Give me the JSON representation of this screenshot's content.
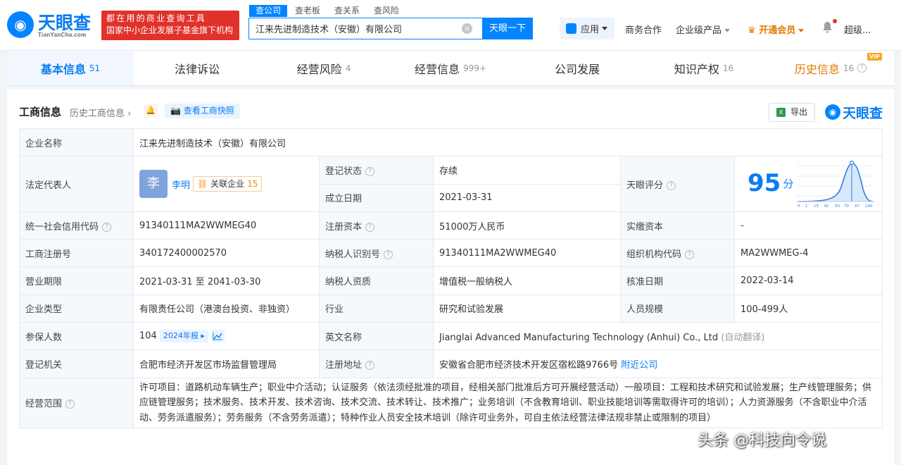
{
  "header": {
    "logo_text": "天眼查",
    "logo_domain": "TianYanCha.com",
    "promo_line1": "都在用的商业查询工具",
    "promo_line2": "国家中小企业发展子基金旗下机构",
    "search_tabs": [
      "查公司",
      "查老板",
      "查关系",
      "查风险"
    ],
    "search_value": "江来先进制造技术（安徽）有限公司",
    "search_button": "天眼一下",
    "apps_label": "应用",
    "nav_business": "商务合作",
    "nav_enterprise": "企业级产品",
    "nav_vip": "开通会员",
    "nav_user": "超级..."
  },
  "tabs": [
    {
      "label": "基本信息",
      "count": "51"
    },
    {
      "label": "法律诉讼",
      "count": ""
    },
    {
      "label": "经营风险",
      "count": "4"
    },
    {
      "label": "经营信息",
      "count": "999+"
    },
    {
      "label": "公司发展",
      "count": ""
    },
    {
      "label": "知识产权",
      "count": "16"
    },
    {
      "label": "历史信息",
      "count": "16",
      "badge": "VIP"
    }
  ],
  "section": {
    "title": "工商信息",
    "history_link": "历史工商信息",
    "snapshot_label": "查看工商快照",
    "export_label": "导出",
    "brand": "天眼查"
  },
  "info": {
    "company_name_label": "企业名称",
    "company_name": "江来先进制造技术（安徽）有限公司",
    "legal_rep_label": "法定代表人",
    "legal_rep_avatar": "李",
    "legal_rep_name": "李明",
    "related_label": "关联企业",
    "related_count": "15",
    "reg_status_label": "登记状态",
    "reg_status": "存续",
    "found_date_label": "成立日期",
    "found_date": "2021-03-31",
    "score_label": "天眼评分",
    "score": "95",
    "score_unit": "分",
    "score_ticks": [
      "0",
      "1",
      "15",
      "30",
      "50",
      "70",
      "97",
      "100"
    ],
    "credit_code_label": "统一社会信用代码",
    "credit_code": "91340111MA2WWMEG40",
    "reg_capital_label": "注册资本",
    "reg_capital": "51000万人民币",
    "paid_capital_label": "实缴资本",
    "paid_capital": "-",
    "reg_no_label": "工商注册号",
    "reg_no": "340172400002570",
    "tax_id_label": "纳税人识别号",
    "tax_id": "91340111MA2WWMEG40",
    "org_code_label": "组织机构代码",
    "org_code": "MA2WWMEG-4",
    "term_label": "营业期限",
    "term": "2021-03-31 至 2041-03-30",
    "taxpayer_label": "纳税人资质",
    "taxpayer": "增值税一般纳税人",
    "approve_label": "核准日期",
    "approve_date": "2022-03-14",
    "type_label": "企业类型",
    "type": "有限责任公司（港澳台投资、非独资）",
    "industry_label": "行业",
    "industry": "研究和试验发展",
    "staff_label": "人员规模",
    "staff": "100-499人",
    "insured_label": "参保人数",
    "insured": "104",
    "report_tag": "2024年报",
    "en_name_label": "英文名称",
    "en_name": "Jianglai Advanced Manufacturing Technology (Anhui) Co., Ltd",
    "auto_translate": "(自动翻译)",
    "authority_label": "登记机关",
    "authority": "合肥市经济开发区市场监督管理局",
    "address_label": "注册地址",
    "address": "安徽省合肥市经济技术开发区宿松路9766号",
    "nearby": "附近公司",
    "scope_label": "经营范围",
    "scope": "许可项目：道路机动车辆生产；职业中介活动；认证服务（依法须经批准的项目，经相关部门批准后方可开展经营活动）一般项目：工程和技术研究和试验发展；生产线管理服务；供应链管理服务；技术服务、技术开发、技术咨询、技术交流、技术转让、技术推广；业务培训（不含教育培训、职业技能培训等需取得许可的培训）；人力资源服务（不含职业中介活动、劳务派遣服务）；劳务服务（不含劳务派遣）；特种作业人员安全技术培训（除许可业务外，可自主依法经营法律法规非禁止或限制的项目）"
  },
  "watermark": "头条 @科技向令说",
  "colors": {
    "brand": "#0084ff",
    "promo": "#e0322b",
    "vip": "#e07b00",
    "status_ok": "#0da85c"
  }
}
